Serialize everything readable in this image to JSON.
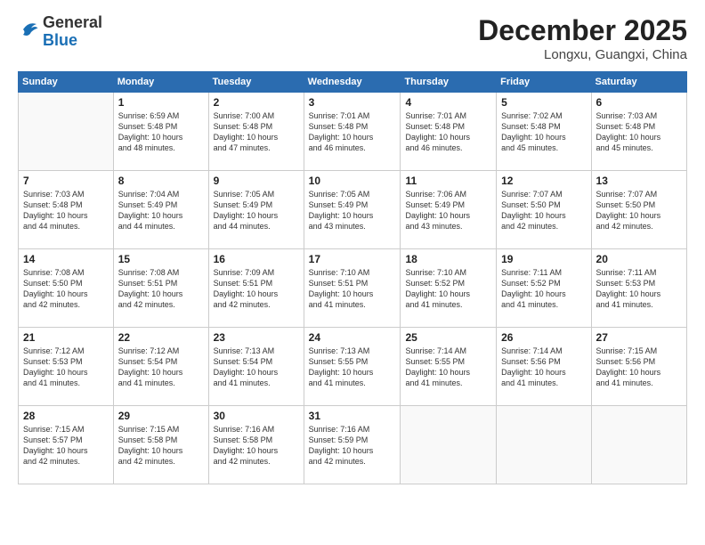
{
  "header": {
    "logo_general": "General",
    "logo_blue": "Blue",
    "main_title": "December 2025",
    "subtitle": "Longxu, Guangxi, China"
  },
  "weekdays": [
    "Sunday",
    "Monday",
    "Tuesday",
    "Wednesday",
    "Thursday",
    "Friday",
    "Saturday"
  ],
  "weeks": [
    [
      {
        "day": "",
        "info": ""
      },
      {
        "day": "1",
        "info": "Sunrise: 6:59 AM\nSunset: 5:48 PM\nDaylight: 10 hours\nand 48 minutes."
      },
      {
        "day": "2",
        "info": "Sunrise: 7:00 AM\nSunset: 5:48 PM\nDaylight: 10 hours\nand 47 minutes."
      },
      {
        "day": "3",
        "info": "Sunrise: 7:01 AM\nSunset: 5:48 PM\nDaylight: 10 hours\nand 46 minutes."
      },
      {
        "day": "4",
        "info": "Sunrise: 7:01 AM\nSunset: 5:48 PM\nDaylight: 10 hours\nand 46 minutes."
      },
      {
        "day": "5",
        "info": "Sunrise: 7:02 AM\nSunset: 5:48 PM\nDaylight: 10 hours\nand 45 minutes."
      },
      {
        "day": "6",
        "info": "Sunrise: 7:03 AM\nSunset: 5:48 PM\nDaylight: 10 hours\nand 45 minutes."
      }
    ],
    [
      {
        "day": "7",
        "info": "Sunrise: 7:03 AM\nSunset: 5:48 PM\nDaylight: 10 hours\nand 44 minutes."
      },
      {
        "day": "8",
        "info": "Sunrise: 7:04 AM\nSunset: 5:49 PM\nDaylight: 10 hours\nand 44 minutes."
      },
      {
        "day": "9",
        "info": "Sunrise: 7:05 AM\nSunset: 5:49 PM\nDaylight: 10 hours\nand 44 minutes."
      },
      {
        "day": "10",
        "info": "Sunrise: 7:05 AM\nSunset: 5:49 PM\nDaylight: 10 hours\nand 43 minutes."
      },
      {
        "day": "11",
        "info": "Sunrise: 7:06 AM\nSunset: 5:49 PM\nDaylight: 10 hours\nand 43 minutes."
      },
      {
        "day": "12",
        "info": "Sunrise: 7:07 AM\nSunset: 5:50 PM\nDaylight: 10 hours\nand 42 minutes."
      },
      {
        "day": "13",
        "info": "Sunrise: 7:07 AM\nSunset: 5:50 PM\nDaylight: 10 hours\nand 42 minutes."
      }
    ],
    [
      {
        "day": "14",
        "info": "Sunrise: 7:08 AM\nSunset: 5:50 PM\nDaylight: 10 hours\nand 42 minutes."
      },
      {
        "day": "15",
        "info": "Sunrise: 7:08 AM\nSunset: 5:51 PM\nDaylight: 10 hours\nand 42 minutes."
      },
      {
        "day": "16",
        "info": "Sunrise: 7:09 AM\nSunset: 5:51 PM\nDaylight: 10 hours\nand 42 minutes."
      },
      {
        "day": "17",
        "info": "Sunrise: 7:10 AM\nSunset: 5:51 PM\nDaylight: 10 hours\nand 41 minutes."
      },
      {
        "day": "18",
        "info": "Sunrise: 7:10 AM\nSunset: 5:52 PM\nDaylight: 10 hours\nand 41 minutes."
      },
      {
        "day": "19",
        "info": "Sunrise: 7:11 AM\nSunset: 5:52 PM\nDaylight: 10 hours\nand 41 minutes."
      },
      {
        "day": "20",
        "info": "Sunrise: 7:11 AM\nSunset: 5:53 PM\nDaylight: 10 hours\nand 41 minutes."
      }
    ],
    [
      {
        "day": "21",
        "info": "Sunrise: 7:12 AM\nSunset: 5:53 PM\nDaylight: 10 hours\nand 41 minutes."
      },
      {
        "day": "22",
        "info": "Sunrise: 7:12 AM\nSunset: 5:54 PM\nDaylight: 10 hours\nand 41 minutes."
      },
      {
        "day": "23",
        "info": "Sunrise: 7:13 AM\nSunset: 5:54 PM\nDaylight: 10 hours\nand 41 minutes."
      },
      {
        "day": "24",
        "info": "Sunrise: 7:13 AM\nSunset: 5:55 PM\nDaylight: 10 hours\nand 41 minutes."
      },
      {
        "day": "25",
        "info": "Sunrise: 7:14 AM\nSunset: 5:55 PM\nDaylight: 10 hours\nand 41 minutes."
      },
      {
        "day": "26",
        "info": "Sunrise: 7:14 AM\nSunset: 5:56 PM\nDaylight: 10 hours\nand 41 minutes."
      },
      {
        "day": "27",
        "info": "Sunrise: 7:15 AM\nSunset: 5:56 PM\nDaylight: 10 hours\nand 41 minutes."
      }
    ],
    [
      {
        "day": "28",
        "info": "Sunrise: 7:15 AM\nSunset: 5:57 PM\nDaylight: 10 hours\nand 42 minutes."
      },
      {
        "day": "29",
        "info": "Sunrise: 7:15 AM\nSunset: 5:58 PM\nDaylight: 10 hours\nand 42 minutes."
      },
      {
        "day": "30",
        "info": "Sunrise: 7:16 AM\nSunset: 5:58 PM\nDaylight: 10 hours\nand 42 minutes."
      },
      {
        "day": "31",
        "info": "Sunrise: 7:16 AM\nSunset: 5:59 PM\nDaylight: 10 hours\nand 42 minutes."
      },
      {
        "day": "",
        "info": ""
      },
      {
        "day": "",
        "info": ""
      },
      {
        "day": "",
        "info": ""
      }
    ]
  ]
}
